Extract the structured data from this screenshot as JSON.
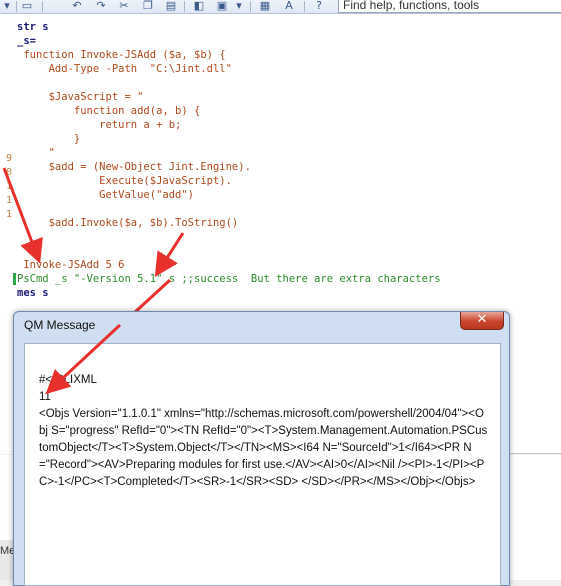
{
  "toolbar": {
    "help_placeholder": "Find help, functions, tools"
  },
  "editor": {
    "lines": [
      {
        "text": "str s"
      },
      {
        "text": "_s="
      },
      {
        "text": " function Invoke-JSAdd ($a, $b) {"
      },
      {
        "text": "     Add-Type -Path  \"C:\\Jint.dll\""
      },
      {
        "text": ""
      },
      {
        "text": "     $JavaScript = \""
      },
      {
        "text": "         function add(a, b) {"
      },
      {
        "text": "             return a + b;"
      },
      {
        "text": "         }"
      },
      {
        "text": "     \""
      },
      {
        "text": "     $add = (New-Object Jint.Engine)."
      },
      {
        "text": "             Execute($JavaScript)."
      },
      {
        "text": "             GetValue(\"add\")"
      },
      {
        "text": ""
      },
      {
        "text": "     $add.Invoke($a, $b).ToString()"
      },
      {
        "text": ""
      },
      {
        "text": ""
      },
      {
        "text": " Invoke-JSAdd 5 6"
      },
      {
        "text": "PsCmd _s \"-Version 5.1\" s ;;success  But there are extra characters"
      },
      {
        "text": "mes s"
      }
    ],
    "gutter_numbers": [
      "9",
      "0",
      "1",
      "1",
      "1"
    ]
  },
  "lower_pane": {
    "label": "Me"
  },
  "dialog": {
    "title": "QM Message",
    "close_label": "✕",
    "message": "#< CLIXML\n11\n<Objs Version=\"1.1.0.1\" xmlns=\"http://schemas.microsoft.com/powershell/2004/04\"><Obj S=\"progress\" RefId=\"0\"><TN RefId=\"0\"><T>System.Management.Automation.PSCustomObject</T><T>System.Object</T></TN><MS><I64 N=\"SourceId\">1</I64><PR N=\"Record\"><AV>Preparing modules for first use.</AV><AI>0</AI><Nil /><PI>-1</PI><PC>-1</PC><T>Completed</T><SR>-1</SR><SD> </SD></PR></MS></Obj></Objs>"
  },
  "colors": {
    "annotation_arrow": "#e8312c",
    "code_string": "#b04a1e",
    "code_comment": "#3c8c3c"
  }
}
